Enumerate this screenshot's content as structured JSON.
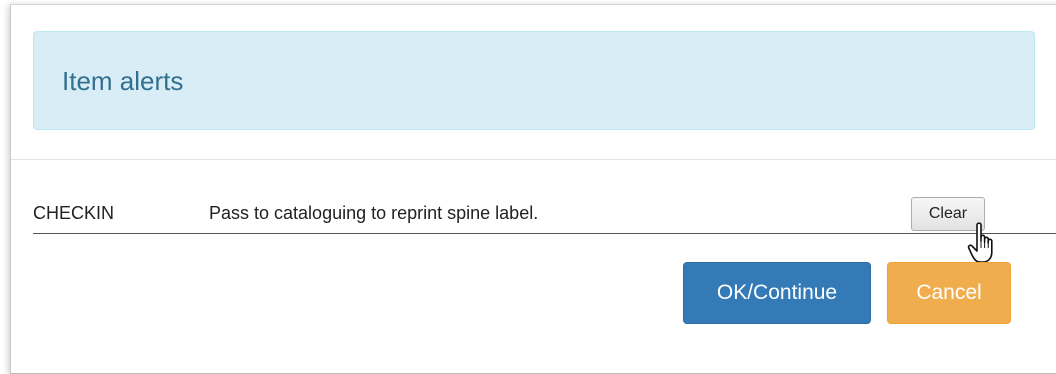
{
  "header": {
    "title": "Item alerts"
  },
  "alerts": [
    {
      "code": "CHECKIN",
      "message": "Pass to cataloguing to reprint spine label.",
      "action_label": "Clear"
    }
  ],
  "footer": {
    "ok_label": "OK/Continue",
    "cancel_label": "Cancel"
  },
  "colors": {
    "header_bg": "#d9edf7",
    "header_text": "#31708f",
    "primary": "#337ab7",
    "warning": "#f0ad4e"
  },
  "icons": {
    "cursor": "hand-pointer-cursor-icon"
  }
}
